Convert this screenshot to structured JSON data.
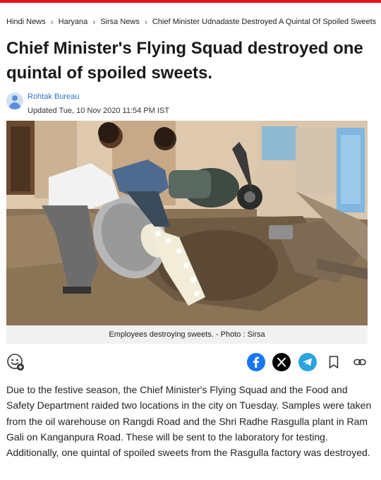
{
  "breadcrumb": {
    "items": [
      "Hindi News",
      "Haryana",
      "Sirsa News",
      "Chief Minister Udnadaste Destroyed A Quintal Of Spoiled Sweets"
    ]
  },
  "article": {
    "headline": "Chief Minister's Flying Squad destroyed one quintal of spoiled sweets.",
    "author": "Rohtak Bureau",
    "updated": "Updated Tue, 10 Nov 2020 11:54 PM IST",
    "photo_caption": "Employees destroying sweets. - Photo : Sirsa",
    "body": "Due to the festive season, the Chief Minister's Flying Squad and the Food and Safety Department raided two locations in the city on Tuesday. Samples were taken from the oil warehouse on Rangdi Road and the Shri Radhe Rasgulla plant in Ram Gali on Kanganpura Road. These will be sent to the laboratory for testing. Additionally, one quintal of spoiled sweets from the Rasgulla factory was destroyed."
  },
  "share_bar": {
    "icons": [
      "reaction-icon",
      "facebook-icon",
      "x-icon",
      "telegram-icon",
      "bookmark-icon",
      "link-icon"
    ]
  },
  "colors": {
    "accent_red": "#e8141b",
    "author_blue": "#2f72c9",
    "facebook": "#1877f2",
    "telegram": "#2aa3df",
    "caption_bg": "#f1f1f1"
  }
}
